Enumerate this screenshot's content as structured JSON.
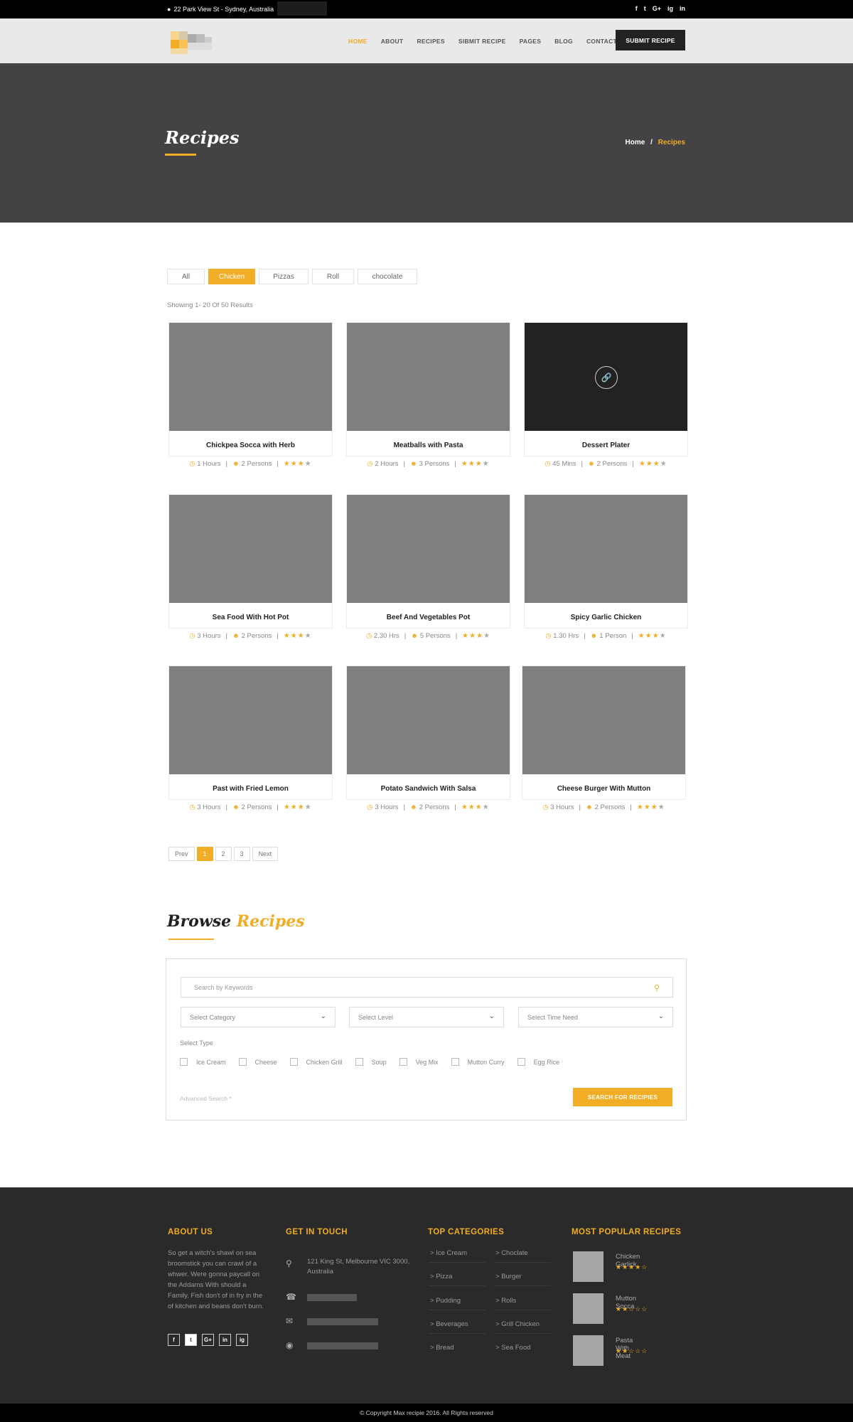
{
  "topbar": {
    "address": "22 Park View St - Sydney, Australia",
    "social": [
      "f",
      "t",
      "G+",
      "ig",
      "in"
    ]
  },
  "nav": {
    "items": [
      "HOME",
      "ABOUT",
      "RECIPES",
      "SIBMIT RECIPE",
      "PAGES",
      "BLOG",
      "CONTACT"
    ],
    "active": "HOME",
    "submit_label": "SUBMIT RECIPE"
  },
  "banner": {
    "title": "Recipes",
    "breadcrumb": {
      "home": "Home",
      "separator": "/",
      "current": "Recipes"
    }
  },
  "filters": [
    "All",
    "Chicken",
    "Pizzas",
    "Roll",
    "chocolate"
  ],
  "filter_active": "Chicken",
  "showing": "Showing 1- 20 Of 50 Results",
  "recipes": [
    {
      "title": "Chickpea Socca  with Herb",
      "time": "1 Hours",
      "persons": "2 Persons",
      "rating": 3
    },
    {
      "title": "Meatballs with Pasta",
      "time": "2 Hours",
      "persons": "3 Persons",
      "rating": 3
    },
    {
      "title": "Dessert Plater",
      "time": "45 Mins",
      "persons": "2 Persons",
      "rating": 3
    },
    {
      "title": "Sea Food With Hot Pot",
      "time": "3 Hours",
      "persons": "2 Persons",
      "rating": 3
    },
    {
      "title": "Beef And Vegetables Pot",
      "time": "2.30 Hrs",
      "persons": "5 Persons",
      "rating": 3
    },
    {
      "title": "Spicy Garlic Chicken",
      "time": "1.30 Hrs",
      "persons": "1 Person",
      "rating": 3
    },
    {
      "title": "Past with Fried Lemon",
      "time": "3 Hours",
      "persons": "2 Persons",
      "rating": 3
    },
    {
      "title": "Potato Sandwich With Salsa",
      "time": "3 Hours",
      "persons": "2 Persons",
      "rating": 3
    },
    {
      "title": "Cheese Burger With Mutton",
      "time": "3 Hours",
      "persons": "2 Persons",
      "rating": 3
    }
  ],
  "pager": {
    "prev": "Prev",
    "pages": [
      "1",
      "2",
      "3"
    ],
    "active": "1",
    "next": "Next"
  },
  "browse": {
    "title_a": "Browse",
    "title_b": "Recipes",
    "keyword_placeholder": "Search by Keywords",
    "selects": [
      "Select Category",
      "Select Level",
      "Select Time Need"
    ],
    "type_label": "Select Type",
    "types": [
      "Ice Cream",
      "Cheese",
      "Chicken Grill",
      "Soup",
      "Veg Mix",
      "Mutton Curry",
      "Egg Rice"
    ],
    "advanced": "Advanced Search *",
    "button": "SEARCH FOR RECIPIES"
  },
  "footer": {
    "about_title": "ABOUT US",
    "about_text": "So get a witch's shawl on sea broomstick you can crawl of a whwer. Were gonna paycall on the Addams With should a Family. Fish don't of  in fry in the of kitchen and beans don't burn.",
    "about_social": [
      "f",
      "t",
      "G+",
      "in",
      "ig"
    ],
    "touch_title": "GET IN TOUCH",
    "touch_address": "121 King St, Melbourne VIC 3000, Australia",
    "cats_title": "TOP CATEGORIES",
    "cats_left": [
      "Ice Cream",
      "Pizza",
      "Pudding",
      "Beverages",
      "Bread"
    ],
    "cats_right": [
      "Choclate",
      "Burger",
      "Rolls",
      "Grill Chicken",
      "Sea Food"
    ],
    "popular_title": "MOST POPULAR RECIPES",
    "popular": [
      {
        "name": "Chicken Garlick",
        "rating": 4
      },
      {
        "name": "Mutton Socca",
        "rating": 2
      },
      {
        "name": "Pasta With Meat",
        "rating": 2
      }
    ]
  },
  "copyright": "© Copyright Max recipie 2016. All Rights reserved",
  "colors": {
    "accent": "#f0ad25",
    "banner": "#444244",
    "footer": "#2a2a2a"
  }
}
